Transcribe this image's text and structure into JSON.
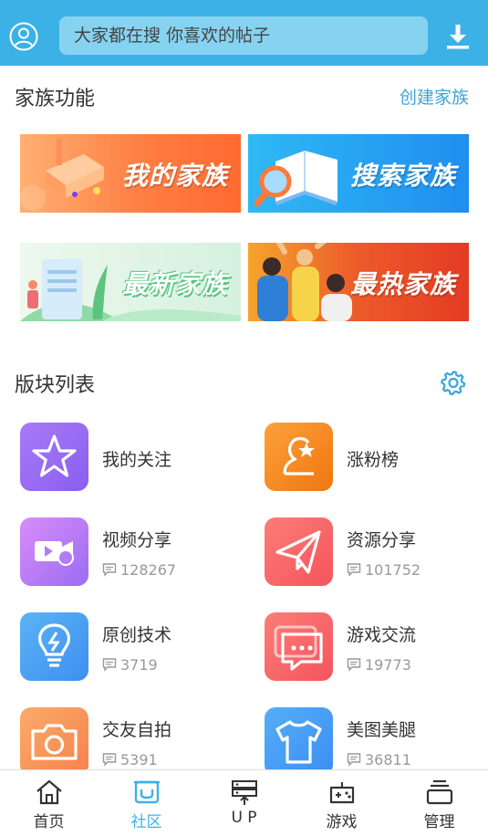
{
  "header": {
    "search_placeholder": "大家都在搜  你喜欢的帖子",
    "avatar_icon": "user-circle-icon",
    "download_icon": "download-icon"
  },
  "family": {
    "title": "家族功能",
    "create_link": "创建家族",
    "banners": [
      {
        "label": "我的家族"
      },
      {
        "label": "搜索家族"
      },
      {
        "label": "最新家族"
      },
      {
        "label": "最热家族"
      }
    ]
  },
  "boards": {
    "title": "版块列表",
    "settings_icon": "gear-icon",
    "items": [
      {
        "name": "我的关注",
        "count": "",
        "icon": "star-icon",
        "color": "#9b6bf0"
      },
      {
        "name": "涨粉榜",
        "count": "",
        "icon": "ranking-icon",
        "color": "#f7871b"
      },
      {
        "name": "视频分享",
        "count": "128267",
        "icon": "video-share-icon",
        "color": "#b97ff6"
      },
      {
        "name": "资源分享",
        "count": "101752",
        "icon": "paper-plane-icon",
        "color": "#f8656a"
      },
      {
        "name": "原创技术",
        "count": "3719",
        "icon": "lightbulb-icon",
        "color": "#4aa0f2"
      },
      {
        "name": "游戏交流",
        "count": "19773",
        "icon": "chat-bubble-icon",
        "color": "#f8656a"
      },
      {
        "name": "交友自拍",
        "count": "5391",
        "icon": "camera-icon",
        "color": "#f8935a"
      },
      {
        "name": "美图美腿",
        "count": "36811",
        "icon": "tshirt-icon",
        "color": "#3f9ef5"
      }
    ]
  },
  "tabbar": {
    "tabs": [
      {
        "label": "首页",
        "icon": "home-icon"
      },
      {
        "label": "社区",
        "icon": "community-icon",
        "active": true
      },
      {
        "label": "U P",
        "icon": "upload-server-icon"
      },
      {
        "label": "游戏",
        "icon": "gamepad-icon"
      },
      {
        "label": "管理",
        "icon": "manage-icon"
      }
    ]
  },
  "colors": {
    "header_bg": "#3cb1e6",
    "search_bg": "#86d3f1",
    "accent": "#3aa6d6"
  }
}
